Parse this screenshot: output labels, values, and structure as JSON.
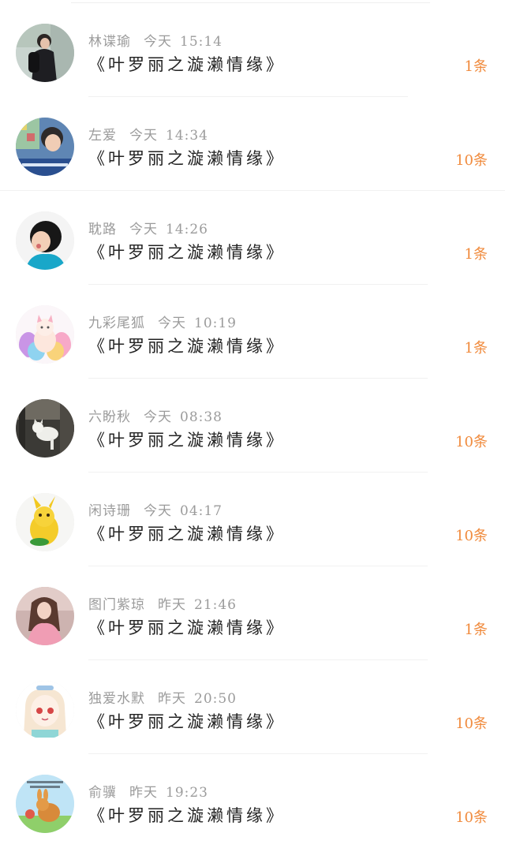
{
  "comments": [
    {
      "name": "林谍瑜",
      "day": "今天",
      "time": "15:14",
      "title": "《叶罗丽之漩濑情缘》",
      "count": "1条",
      "avatar": "avatar-person-backpack"
    },
    {
      "name": "左爱",
      "day": "今天",
      "time": "14:34",
      "title": "《叶罗丽之漩濑情缘》",
      "count": "10条",
      "avatar": "avatar-boy-photo"
    },
    {
      "name": "耽路",
      "day": "今天",
      "time": "14:26",
      "title": "《叶罗丽之漩濑情缘》",
      "count": "1条",
      "avatar": "avatar-girl-blue-hood"
    },
    {
      "name": "九彩尾狐",
      "day": "今天",
      "time": "10:19",
      "title": "《叶罗丽之漩濑情缘》",
      "count": "1条",
      "avatar": "avatar-nine-tail-fox"
    },
    {
      "name": "六盼秋",
      "day": "今天",
      "time": "08:38",
      "title": "《叶罗丽之漩濑情缘》",
      "count": "10条",
      "avatar": "avatar-cat-window"
    },
    {
      "name": "闲诗珊",
      "day": "今天",
      "time": "04:17",
      "title": "《叶罗丽之漩濑情缘》",
      "count": "10条",
      "avatar": "avatar-yellow-pikachu"
    },
    {
      "name": "图门紫琼",
      "day": "昨天",
      "time": "21:46",
      "title": "《叶罗丽之漩濑情缘》",
      "count": "1条",
      "avatar": "avatar-girl-pink"
    },
    {
      "name": "独爱水默",
      "day": "昨天",
      "time": "20:50",
      "title": "《叶罗丽之漩濑情缘》",
      "count": "10条",
      "avatar": "avatar-anime-girl"
    },
    {
      "name": "俞骥",
      "day": "昨天",
      "time": "19:23",
      "title": "《叶罗丽之漩濑情缘》",
      "count": "10条",
      "avatar": "avatar-cartoon-rabbit"
    }
  ],
  "colors": {
    "meta": "#9b9b9b",
    "title": "#222222",
    "count": "#f08a3c",
    "divider": "#f1f1f1"
  }
}
